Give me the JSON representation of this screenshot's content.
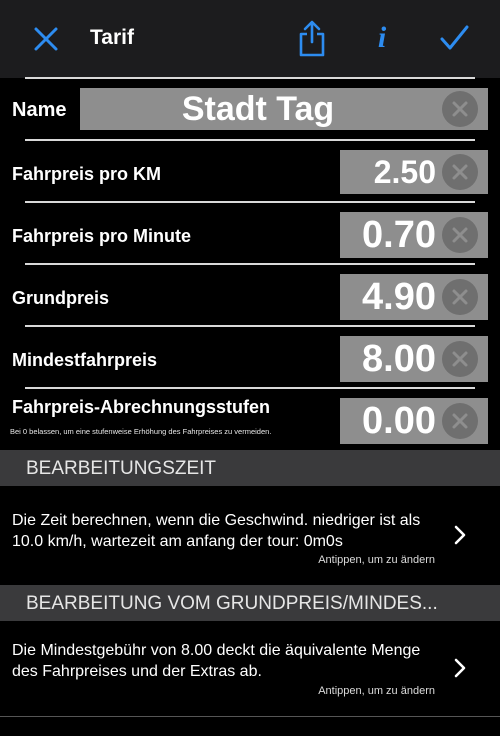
{
  "nav": {
    "title": "Tarif",
    "close_icon": "close-icon",
    "share_icon": "share-icon",
    "info_label": "i",
    "done_icon": "checkmark-icon",
    "accent": "#2d8cf0"
  },
  "fields": {
    "name": {
      "label": "Name",
      "value": "Stadt Tag"
    },
    "price_per_km": {
      "label": "Fahrpreis pro KM",
      "value": "2.50"
    },
    "price_per_minute": {
      "label": "Fahrpreis pro Minute",
      "value": "0.70"
    },
    "base_price": {
      "label": "Grundpreis",
      "value": "4.90"
    },
    "min_price": {
      "label": "Mindestfahrpreis",
      "value": "8.00"
    },
    "billing_steps": {
      "label": "Fahrpreis-Abrechnungsstufen",
      "value": "0.00",
      "hint": "Bei 0 belassen, um eine stufenweise Erhöhung des Fahrpreises zu vermeiden."
    }
  },
  "sections": {
    "processing_time": {
      "header": "BEARBEITUNGSZEIT",
      "text": "Die Zeit berechnen, wenn die Geschwind. niedriger ist als 10.0 km/h, wartezeit am anfang der tour: 0m0s",
      "tap_hint": "Antippen, um zu ändern"
    },
    "base_price_processing": {
      "header": "BEARBEITUNG VOM GRUNDPREIS/MINDES...",
      "text": "Die Mindestgebühr von 8.00 deckt die äquivalente Menge des Fahrpreises und der Extras ab.",
      "tap_hint": "Antippen, um zu ändern"
    }
  }
}
